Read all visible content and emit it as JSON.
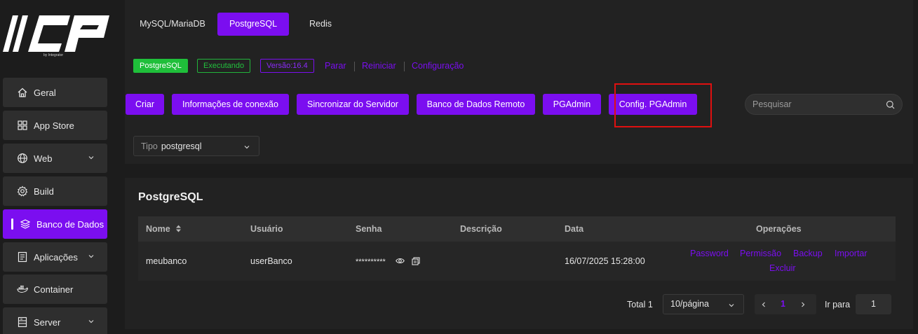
{
  "brand": {
    "logo_text": "CP",
    "logo_sub": "by Integrator"
  },
  "sidebar": {
    "items": [
      {
        "label": "Geral",
        "icon": "home-icon"
      },
      {
        "label": "App Store",
        "icon": "grid-icon"
      },
      {
        "label": "Web",
        "icon": "globe-icon",
        "expandable": true
      },
      {
        "label": "Build",
        "icon": "gear-icon"
      },
      {
        "label": "Banco de Dados",
        "icon": "database-icon",
        "active": true
      },
      {
        "label": "Aplicações",
        "icon": "app-icon",
        "expandable": true
      },
      {
        "label": "Container",
        "icon": "docker-icon"
      },
      {
        "label": "Server",
        "icon": "server-icon",
        "expandable": true
      }
    ]
  },
  "tabs": [
    {
      "label": "MySQL/MariaDB"
    },
    {
      "label": "PostgreSQL",
      "active": true
    },
    {
      "label": "Redis"
    }
  ],
  "status": {
    "app_tag": "PostgreSQL",
    "state_tag": "Executando",
    "version_tag": "Versão:16.4",
    "actions": [
      "Parar",
      "Reiniciar",
      "Configuração"
    ]
  },
  "toolbar": {
    "buttons": [
      "Criar",
      "Informações de conexão",
      "Sincronizar do Servidor",
      "Banco de Dados Remoto",
      "PGAdmin",
      "Config. PGAdmin"
    ],
    "search_placeholder": "Pesquisar"
  },
  "filter": {
    "label": "Tipo",
    "value": "postgresql"
  },
  "table": {
    "title": "PostgreSQL",
    "columns": [
      "Nome",
      "Usuário",
      "Senha",
      "Descrição",
      "Data",
      "Operações"
    ],
    "rows": [
      {
        "name": "meubanco",
        "user": "userBanco",
        "password": "**********",
        "description": "",
        "date": "16/07/2025 15:28:00",
        "operations": [
          "Password",
          "Permissão",
          "Backup",
          "Importar",
          "Excluir"
        ]
      }
    ]
  },
  "pagination": {
    "total": "Total 1",
    "page_size": "10/página",
    "current_page": "1",
    "goto_label": "Ir para",
    "goto_value": "1"
  },
  "colors": {
    "accent": "#7b0ef0",
    "success": "#1fbf3a",
    "highlight": "#e01010"
  }
}
